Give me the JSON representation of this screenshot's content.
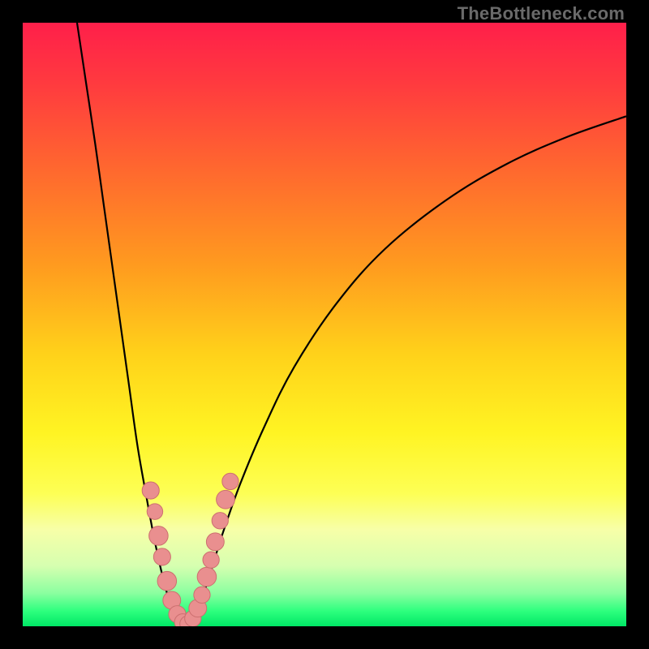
{
  "watermark": "TheBottleneck.com",
  "gradient": {
    "stops": [
      {
        "offset": 0.0,
        "color": "#ff1f4a"
      },
      {
        "offset": 0.1,
        "color": "#ff3a3f"
      },
      {
        "offset": 0.25,
        "color": "#ff6a2e"
      },
      {
        "offset": 0.4,
        "color": "#ff9a1f"
      },
      {
        "offset": 0.55,
        "color": "#ffd21a"
      },
      {
        "offset": 0.68,
        "color": "#fff423"
      },
      {
        "offset": 0.78,
        "color": "#fdff55"
      },
      {
        "offset": 0.84,
        "color": "#f7ffa8"
      },
      {
        "offset": 0.9,
        "color": "#d6ffb0"
      },
      {
        "offset": 0.945,
        "color": "#8bffa0"
      },
      {
        "offset": 0.975,
        "color": "#2dff7e"
      },
      {
        "offset": 1.0,
        "color": "#00e765"
      }
    ]
  },
  "chart_data": {
    "type": "line",
    "title": "",
    "xlabel": "",
    "ylabel": "",
    "xlim": [
      0,
      100
    ],
    "ylim": [
      0,
      100
    ],
    "grid": false,
    "series": [
      {
        "name": "left-branch",
        "values": [
          {
            "x": 9.0,
            "y": 100.0
          },
          {
            "x": 10.5,
            "y": 90.0
          },
          {
            "x": 12.0,
            "y": 80.0
          },
          {
            "x": 13.4,
            "y": 70.0
          },
          {
            "x": 14.8,
            "y": 60.0
          },
          {
            "x": 16.2,
            "y": 50.0
          },
          {
            "x": 17.6,
            "y": 40.0
          },
          {
            "x": 19.0,
            "y": 30.0
          },
          {
            "x": 20.4,
            "y": 22.0
          },
          {
            "x": 21.7,
            "y": 15.0
          },
          {
            "x": 23.0,
            "y": 9.0
          },
          {
            "x": 24.2,
            "y": 4.5
          },
          {
            "x": 25.3,
            "y": 1.8
          },
          {
            "x": 26.3,
            "y": 0.4
          },
          {
            "x": 27.0,
            "y": 0.0
          }
        ]
      },
      {
        "name": "right-branch",
        "values": [
          {
            "x": 27.0,
            "y": 0.0
          },
          {
            "x": 28.0,
            "y": 0.8
          },
          {
            "x": 29.3,
            "y": 3.5
          },
          {
            "x": 31.0,
            "y": 8.5
          },
          {
            "x": 33.0,
            "y": 15.0
          },
          {
            "x": 36.0,
            "y": 23.5
          },
          {
            "x": 40.0,
            "y": 33.0
          },
          {
            "x": 45.0,
            "y": 43.0
          },
          {
            "x": 52.0,
            "y": 53.5
          },
          {
            "x": 60.0,
            "y": 62.5
          },
          {
            "x": 70.0,
            "y": 70.5
          },
          {
            "x": 80.0,
            "y": 76.5
          },
          {
            "x": 90.0,
            "y": 81.0
          },
          {
            "x": 100.0,
            "y": 84.5
          }
        ]
      }
    ],
    "markers": [
      {
        "x": 21.2,
        "y": 22.5,
        "r": 1.6
      },
      {
        "x": 21.9,
        "y": 19.0,
        "r": 1.4
      },
      {
        "x": 22.5,
        "y": 15.0,
        "r": 1.9
      },
      {
        "x": 23.1,
        "y": 11.5,
        "r": 1.6
      },
      {
        "x": 23.9,
        "y": 7.5,
        "r": 1.9
      },
      {
        "x": 24.7,
        "y": 4.3,
        "r": 1.7
      },
      {
        "x": 25.6,
        "y": 2.0,
        "r": 1.6
      },
      {
        "x": 26.5,
        "y": 0.7,
        "r": 1.5
      },
      {
        "x": 27.4,
        "y": 0.4,
        "r": 1.5
      },
      {
        "x": 28.2,
        "y": 1.3,
        "r": 1.5
      },
      {
        "x": 29.0,
        "y": 3.0,
        "r": 1.7
      },
      {
        "x": 29.7,
        "y": 5.2,
        "r": 1.5
      },
      {
        "x": 30.5,
        "y": 8.2,
        "r": 1.9
      },
      {
        "x": 31.2,
        "y": 11.0,
        "r": 1.5
      },
      {
        "x": 31.9,
        "y": 14.0,
        "r": 1.7
      },
      {
        "x": 32.7,
        "y": 17.5,
        "r": 1.5
      },
      {
        "x": 33.6,
        "y": 21.0,
        "r": 1.8
      },
      {
        "x": 34.4,
        "y": 24.0,
        "r": 1.5
      }
    ],
    "marker_color": "#e98f8f",
    "marker_stroke": "#cc6f6f",
    "curve_color": "#000000"
  }
}
